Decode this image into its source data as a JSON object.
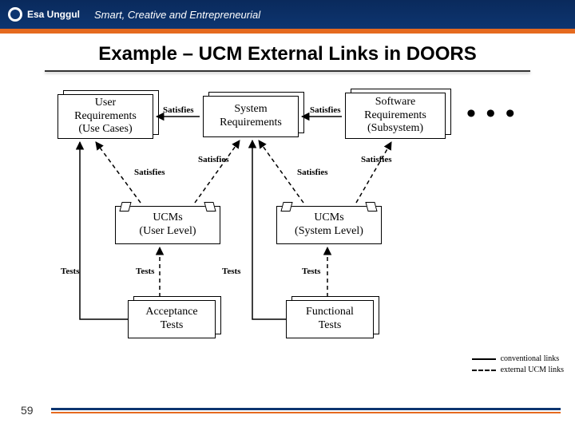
{
  "header": {
    "brand": "Esa Unggul",
    "tagline": "Smart, Creative and Entrepreneurial"
  },
  "title": "Example – UCM External Links in DOORS",
  "nodes": {
    "user_req": {
      "line1": "User",
      "line2": "Requirements",
      "line3": "(Use Cases)"
    },
    "sys_req": {
      "line1": "System",
      "line2": "Requirements"
    },
    "sw_req": {
      "line1": "Software",
      "line2": "Requirements",
      "line3": "(Subsystem)"
    },
    "ucm_user": {
      "line1": "UCMs",
      "line2": "(User Level)"
    },
    "ucm_sys": {
      "line1": "UCMs",
      "line2": "(System Level)"
    },
    "acc_tests": {
      "line1": "Acceptance",
      "line2": "Tests"
    },
    "func_tests": {
      "line1": "Functional",
      "line2": "Tests"
    }
  },
  "labels": {
    "satisfies": "Satisfies",
    "tests": "Tests"
  },
  "ellipsis": "• • •",
  "legend": {
    "conventional": "conventional links",
    "external": "external UCM links"
  },
  "page": "59"
}
